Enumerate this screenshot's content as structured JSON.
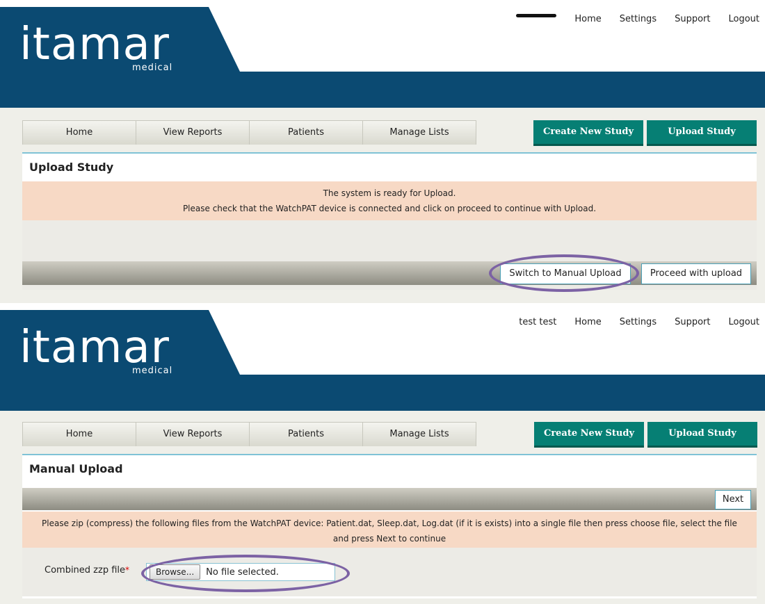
{
  "screens": [
    {
      "logo": {
        "main": "itamar",
        "sub": "medical"
      },
      "top_nav": {
        "user": "",
        "home": "Home",
        "settings": "Settings",
        "support": "Support",
        "logout": "Logout"
      },
      "tabs": [
        "Home",
        "View Reports",
        "Patients",
        "Manage Lists"
      ],
      "actions": {
        "create": "Create New Study",
        "upload": "Upload Study"
      },
      "page_title": "Upload Study",
      "message_line1": "The system is ready for Upload.",
      "message_line2": "Please check that the WatchPAT device is connected and click on proceed to continue with Upload.",
      "switch_button": "Switch to Manual Upload",
      "proceed_button": "Proceed with upload"
    },
    {
      "logo": {
        "main": "itamar",
        "sub": "medical"
      },
      "top_nav": {
        "user": "test test",
        "home": "Home",
        "settings": "Settings",
        "support": "Support",
        "logout": "Logout"
      },
      "tabs": [
        "Home",
        "View Reports",
        "Patients",
        "Manage Lists"
      ],
      "actions": {
        "create": "Create New Study",
        "upload": "Upload Study"
      },
      "page_title": "Manual Upload",
      "next_button": "Next",
      "message_line1": "Please zip (compress) the following files from the WatchPAT device: Patient.dat, Sleep.dat, Log.dat (if it is exists) into a single file then press choose file, select the file",
      "message_line2": "and press Next to continue",
      "file_label": "Combined zzp file",
      "required_marker": "*",
      "browse_button": "Browse...",
      "file_status": "No file selected."
    }
  ],
  "colors": {
    "header_blue": "#0b4a72",
    "teal_button": "#067f74",
    "message_bg": "#f7d9c5",
    "highlight": "#7c62a4"
  }
}
